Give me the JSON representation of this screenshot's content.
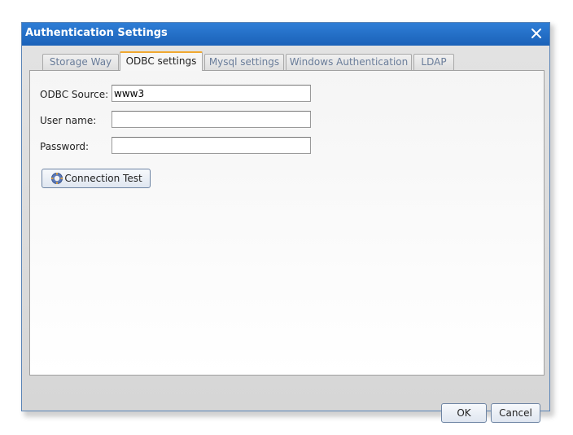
{
  "dialog": {
    "title": "Authentication Settings",
    "close_icon": "close-icon"
  },
  "tabs": [
    {
      "label": "Storage Way"
    },
    {
      "label": "ODBC settings"
    },
    {
      "label": "Mysql settings"
    },
    {
      "label": "Windows Authentication"
    },
    {
      "label": "LDAP"
    }
  ],
  "active_tab": "ODBC settings",
  "form": {
    "odbc_source_label": "ODBC Source:",
    "odbc_source_value": "www3",
    "user_name_label": "User name:",
    "user_name_value": "",
    "password_label": "Password:",
    "password_value": ""
  },
  "buttons": {
    "connection_test": "Connection Test",
    "connection_test_icon": "gear-icon",
    "ok": "OK",
    "cancel": "Cancel"
  },
  "colors": {
    "titlebar": "#1f6bc4",
    "active_tab_accent": "#f0a830"
  }
}
